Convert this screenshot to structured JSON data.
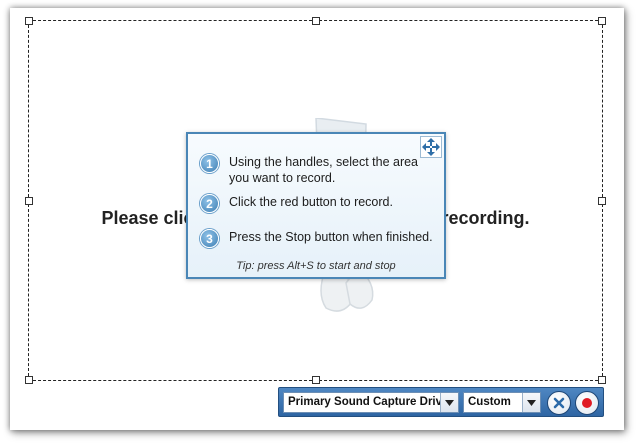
{
  "background": {
    "message": "Please click the red button to begin the recording.",
    "logo": "snipping-scissors-logo"
  },
  "instructions": {
    "steps": [
      {
        "number": "1",
        "text": "Using the handles, select the area you want to record."
      },
      {
        "number": "2",
        "text": "Click the red button to record."
      },
      {
        "number": "3",
        "text": "Press the Stop button when finished."
      }
    ],
    "tip": "Tip: press Alt+S to start and stop",
    "move_icon": "move-arrows-icon"
  },
  "toolbar": {
    "audio_driver": "Primary Sound Capture Driver",
    "mode": "Custom",
    "close_icon": "close-icon",
    "record_icon": "record-icon"
  },
  "colors": {
    "accent": "#4a86b6",
    "toolbar": "#3a72b0",
    "record": "#e01b24"
  }
}
